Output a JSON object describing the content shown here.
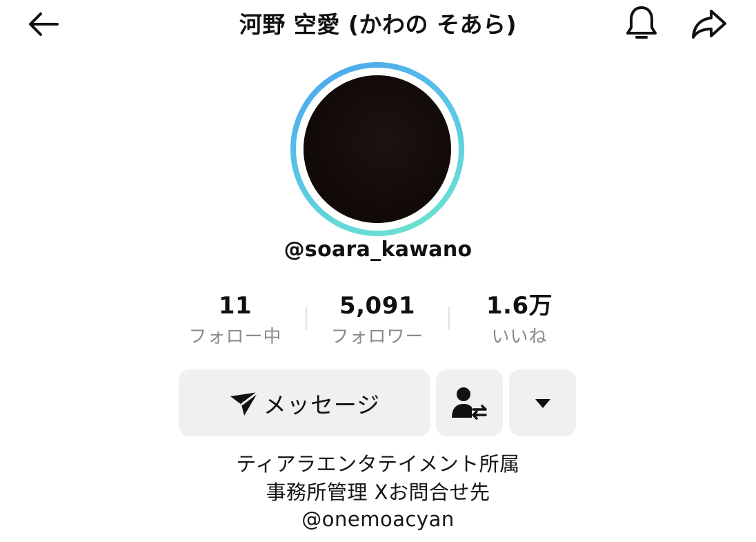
{
  "header": {
    "title": "河野 空愛 (かわの そあら)",
    "back_icon": "arrow-left-icon",
    "bell_icon": "bell-icon",
    "share_icon": "share-arrow-icon"
  },
  "profile": {
    "username": "@soara_kawano",
    "avatar_ring_colors": [
      "#4aa3ef",
      "#70e8cc"
    ]
  },
  "stats": [
    {
      "value": "11",
      "label": "フォロー中"
    },
    {
      "value": "5,091",
      "label": "フォロワー"
    },
    {
      "value": "1.6万",
      "label": "いいね"
    }
  ],
  "actions": {
    "message_label": "メッセージ",
    "message_icon": "send-icon",
    "friend_icon": "user-swap-icon",
    "more_icon": "caret-down-icon"
  },
  "bio": {
    "line1": "ティアラエンタテイメント所属",
    "line2": "事務所管理 Xお問合せ先",
    "line3": "@onemoacyan"
  }
}
